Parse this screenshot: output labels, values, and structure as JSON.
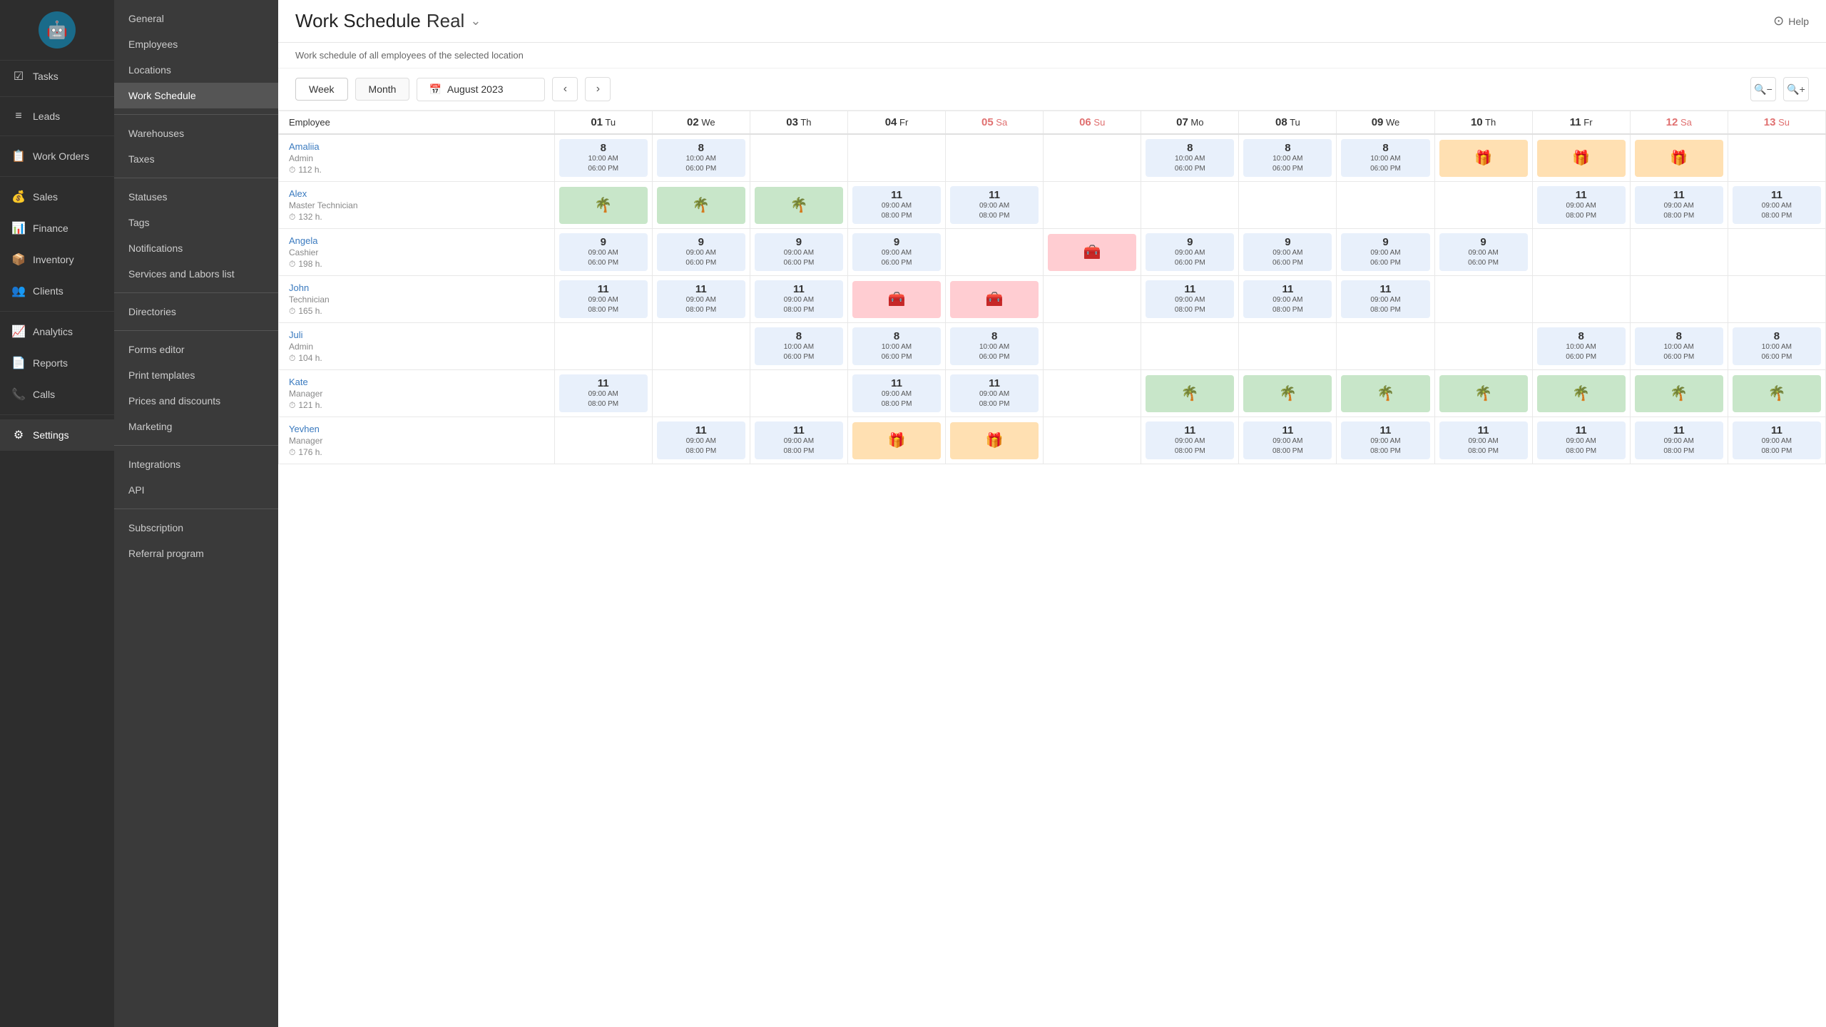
{
  "app": {
    "logo_emoji": "🤖",
    "logo_bg": "#1a6b8a"
  },
  "left_nav": {
    "items": [
      {
        "id": "tasks",
        "label": "Tasks",
        "icon": "☑"
      },
      {
        "id": "leads",
        "label": "Leads",
        "icon": "≡"
      },
      {
        "id": "work-orders",
        "label": "Work Orders",
        "icon": "📋"
      },
      {
        "id": "sales",
        "label": "Sales",
        "icon": "💰"
      },
      {
        "id": "finance",
        "label": "Finance",
        "icon": "📊"
      },
      {
        "id": "inventory",
        "label": "Inventory",
        "icon": "📦"
      },
      {
        "id": "clients",
        "label": "Clients",
        "icon": "👥"
      },
      {
        "id": "analytics",
        "label": "Analytics",
        "icon": "📈"
      },
      {
        "id": "reports",
        "label": "Reports",
        "icon": "📄"
      },
      {
        "id": "calls",
        "label": "Calls",
        "icon": "📞"
      },
      {
        "id": "settings",
        "label": "Settings",
        "icon": "⚙",
        "active": true
      }
    ]
  },
  "sidebar": {
    "items": [
      {
        "id": "general",
        "label": "General",
        "active": false
      },
      {
        "id": "employees",
        "label": "Employees",
        "active": false
      },
      {
        "id": "locations",
        "label": "Locations",
        "active": false
      },
      {
        "id": "work-schedule",
        "label": "Work Schedule",
        "active": true
      },
      {
        "id": "warehouses",
        "label": "Warehouses",
        "active": false
      },
      {
        "id": "taxes",
        "label": "Taxes",
        "active": false
      },
      {
        "id": "statuses",
        "label": "Statuses",
        "active": false
      },
      {
        "id": "tags",
        "label": "Tags",
        "active": false
      },
      {
        "id": "notifications",
        "label": "Notifications",
        "active": false
      },
      {
        "id": "services-labors",
        "label": "Services and Labors list",
        "active": false
      },
      {
        "id": "directories",
        "label": "Directories",
        "active": false
      },
      {
        "id": "forms-editor",
        "label": "Forms editor",
        "active": false
      },
      {
        "id": "print-templates",
        "label": "Print templates",
        "active": false
      },
      {
        "id": "prices-discounts",
        "label": "Prices and discounts",
        "active": false
      },
      {
        "id": "marketing",
        "label": "Marketing",
        "active": false
      },
      {
        "id": "integrations",
        "label": "Integrations",
        "active": false
      },
      {
        "id": "api",
        "label": "API",
        "active": false
      },
      {
        "id": "subscription",
        "label": "Subscription",
        "active": false
      },
      {
        "id": "referral",
        "label": "Referral program",
        "active": false
      }
    ]
  },
  "header": {
    "title": "Work Schedule",
    "subtitle_name": "Real",
    "subtitle": "Work schedule of all employees of the selected location",
    "help_label": "Help"
  },
  "controls": {
    "week_label": "Week",
    "month_label": "Month",
    "active_tab": "Week",
    "date_label": "August 2023",
    "calendar_icon": "📅",
    "prev_arrow": "‹",
    "next_arrow": "›",
    "zoom_out": "🔍",
    "zoom_in": "🔍"
  },
  "schedule": {
    "employee_col_header": "Employee",
    "days": [
      {
        "num": "01",
        "day": "Tu",
        "weekend": false
      },
      {
        "num": "02",
        "day": "We",
        "weekend": false
      },
      {
        "num": "03",
        "day": "Th",
        "weekend": false
      },
      {
        "num": "04",
        "day": "Fr",
        "weekend": false
      },
      {
        "num": "05",
        "day": "Sa",
        "weekend": true
      },
      {
        "num": "06",
        "day": "Su",
        "weekend": true
      },
      {
        "num": "07",
        "day": "Mo",
        "weekend": false
      },
      {
        "num": "08",
        "day": "Tu",
        "weekend": false
      },
      {
        "num": "09",
        "day": "We",
        "weekend": false
      },
      {
        "num": "10",
        "day": "Th",
        "weekend": false
      },
      {
        "num": "11",
        "day": "Fr",
        "weekend": false
      },
      {
        "num": "12",
        "day": "Sa",
        "weekend": true
      },
      {
        "num": "13",
        "day": "Su",
        "weekend": true
      }
    ],
    "employees": [
      {
        "name": "Amaliia",
        "role": "Admin",
        "hours": "112 h.",
        "schedule": [
          {
            "type": "work",
            "hours": "8",
            "time1": "10:00 AM",
            "time2": "06:00 PM"
          },
          {
            "type": "work",
            "hours": "8",
            "time1": "10:00 AM",
            "time2": "06:00 PM"
          },
          {
            "type": "empty"
          },
          {
            "type": "empty"
          },
          {
            "type": "empty"
          },
          {
            "type": "empty"
          },
          {
            "type": "work",
            "hours": "8",
            "time1": "10:00 AM",
            "time2": "06:00 PM"
          },
          {
            "type": "work",
            "hours": "8",
            "time1": "10:00 AM",
            "time2": "06:00 PM"
          },
          {
            "type": "work",
            "hours": "8",
            "time1": "10:00 AM",
            "time2": "06:00 PM"
          },
          {
            "type": "holiday"
          },
          {
            "type": "holiday"
          },
          {
            "type": "holiday"
          },
          {
            "type": "empty"
          }
        ]
      },
      {
        "name": "Alex",
        "role": "Master Technician",
        "hours": "132 h.",
        "schedule": [
          {
            "type": "vacation"
          },
          {
            "type": "vacation"
          },
          {
            "type": "vacation"
          },
          {
            "type": "work",
            "hours": "11",
            "time1": "09:00 AM",
            "time2": "08:00 PM"
          },
          {
            "type": "work",
            "hours": "11",
            "time1": "09:00 AM",
            "time2": "08:00 PM"
          },
          {
            "type": "empty"
          },
          {
            "type": "empty"
          },
          {
            "type": "empty"
          },
          {
            "type": "empty"
          },
          {
            "type": "empty"
          },
          {
            "type": "work",
            "hours": "11",
            "time1": "09:00 AM",
            "time2": "08:00 PM"
          },
          {
            "type": "work",
            "hours": "11",
            "time1": "09:00 AM",
            "time2": "08:00 PM"
          },
          {
            "type": "work",
            "hours": "11",
            "time1": "09:00 AM",
            "time2": "08:00 PM"
          }
        ]
      },
      {
        "name": "Angela",
        "role": "Cashier",
        "hours": "198 h.",
        "schedule": [
          {
            "type": "work",
            "hours": "9",
            "time1": "09:00 AM",
            "time2": "06:00 PM"
          },
          {
            "type": "work",
            "hours": "9",
            "time1": "09:00 AM",
            "time2": "06:00 PM"
          },
          {
            "type": "work",
            "hours": "9",
            "time1": "09:00 AM",
            "time2": "06:00 PM"
          },
          {
            "type": "work",
            "hours": "9",
            "time1": "09:00 AM",
            "time2": "06:00 PM"
          },
          {
            "type": "empty"
          },
          {
            "type": "sick"
          },
          {
            "type": "work",
            "hours": "9",
            "time1": "09:00 AM",
            "time2": "06:00 PM"
          },
          {
            "type": "work",
            "hours": "9",
            "time1": "09:00 AM",
            "time2": "06:00 PM"
          },
          {
            "type": "work",
            "hours": "9",
            "time1": "09:00 AM",
            "time2": "06:00 PM"
          },
          {
            "type": "work",
            "hours": "9",
            "time1": "09:00 AM",
            "time2": "06:00 PM"
          },
          {
            "type": "empty"
          },
          {
            "type": "empty"
          },
          {
            "type": "empty"
          }
        ]
      },
      {
        "name": "John",
        "role": "Technician",
        "hours": "165 h.",
        "schedule": [
          {
            "type": "work",
            "hours": "11",
            "time1": "09:00 AM",
            "time2": "08:00 PM"
          },
          {
            "type": "work",
            "hours": "11",
            "time1": "09:00 AM",
            "time2": "08:00 PM"
          },
          {
            "type": "work",
            "hours": "11",
            "time1": "09:00 AM",
            "time2": "08:00 PM"
          },
          {
            "type": "sick"
          },
          {
            "type": "sick"
          },
          {
            "type": "empty"
          },
          {
            "type": "work",
            "hours": "11",
            "time1": "09:00 AM",
            "time2": "08:00 PM"
          },
          {
            "type": "work",
            "hours": "11",
            "time1": "09:00 AM",
            "time2": "08:00 PM"
          },
          {
            "type": "work",
            "hours": "11",
            "time1": "09:00 AM",
            "time2": "08:00 PM"
          },
          {
            "type": "empty"
          },
          {
            "type": "empty"
          },
          {
            "type": "empty"
          },
          {
            "type": "empty"
          }
        ]
      },
      {
        "name": "Juli",
        "role": "Admin",
        "hours": "104 h.",
        "schedule": [
          {
            "type": "empty"
          },
          {
            "type": "empty"
          },
          {
            "type": "work",
            "hours": "8",
            "time1": "10:00 AM",
            "time2": "06:00 PM"
          },
          {
            "type": "work",
            "hours": "8",
            "time1": "10:00 AM",
            "time2": "06:00 PM"
          },
          {
            "type": "work",
            "hours": "8",
            "time1": "10:00 AM",
            "time2": "06:00 PM"
          },
          {
            "type": "empty"
          },
          {
            "type": "empty"
          },
          {
            "type": "empty"
          },
          {
            "type": "empty"
          },
          {
            "type": "empty"
          },
          {
            "type": "work",
            "hours": "8",
            "time1": "10:00 AM",
            "time2": "06:00 PM"
          },
          {
            "type": "work",
            "hours": "8",
            "time1": "10:00 AM",
            "time2": "06:00 PM"
          },
          {
            "type": "work",
            "hours": "8",
            "time1": "10:00 AM",
            "time2": "06:00 PM"
          }
        ]
      },
      {
        "name": "Kate",
        "role": "Manager",
        "hours": "121 h.",
        "schedule": [
          {
            "type": "work",
            "hours": "11",
            "time1": "09:00 AM",
            "time2": "08:00 PM"
          },
          {
            "type": "empty"
          },
          {
            "type": "empty"
          },
          {
            "type": "work",
            "hours": "11",
            "time1": "09:00 AM",
            "time2": "08:00 PM"
          },
          {
            "type": "work",
            "hours": "11",
            "time1": "09:00 AM",
            "time2": "08:00 PM"
          },
          {
            "type": "empty"
          },
          {
            "type": "vacation"
          },
          {
            "type": "vacation"
          },
          {
            "type": "vacation"
          },
          {
            "type": "vacation"
          },
          {
            "type": "vacation"
          },
          {
            "type": "vacation"
          },
          {
            "type": "vacation"
          }
        ]
      },
      {
        "name": "Yevhen",
        "role": "Manager",
        "hours": "176 h.",
        "schedule": [
          {
            "type": "empty"
          },
          {
            "type": "work",
            "hours": "11",
            "time1": "09:00 AM",
            "time2": "08:00 PM"
          },
          {
            "type": "work",
            "hours": "11",
            "time1": "09:00 AM",
            "time2": "08:00 PM"
          },
          {
            "type": "holiday"
          },
          {
            "type": "holiday"
          },
          {
            "type": "empty"
          },
          {
            "type": "work",
            "hours": "11",
            "time1": "09:00 AM",
            "time2": "08:00 PM"
          },
          {
            "type": "work",
            "hours": "11",
            "time1": "09:00 AM",
            "time2": "08:00 PM"
          },
          {
            "type": "work",
            "hours": "11",
            "time1": "09:00 AM",
            "time2": "08:00 PM"
          },
          {
            "type": "work",
            "hours": "11",
            "time1": "09:00 AM",
            "time2": "08:00 PM"
          },
          {
            "type": "work",
            "hours": "11",
            "time1": "09:00 AM",
            "time2": "08:00 PM"
          },
          {
            "type": "work",
            "hours": "11",
            "time1": "09:00 AM",
            "time2": "08:00 PM"
          },
          {
            "type": "work",
            "hours": "11",
            "time1": "09:00 AM",
            "time2": "08:00 PM"
          }
        ]
      }
    ]
  }
}
